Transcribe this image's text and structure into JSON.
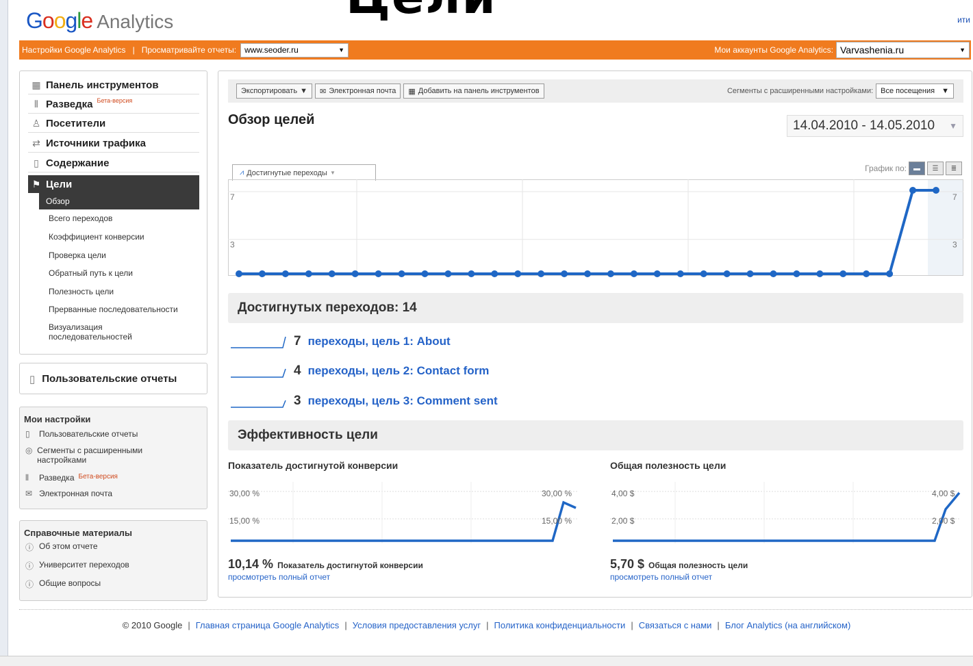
{
  "slide_title": "Цели",
  "header": {
    "logo_google": "Google",
    "logo_product": "Analytics",
    "top_right": "ити"
  },
  "orangebar": {
    "settings_link": "Настройки Google Analytics",
    "view_reports_label": "Просматривайте отчеты:",
    "site_select": "www.seoder.ru",
    "accounts_label": "Мои аккаунты Google Analytics:",
    "account_select": "Varvashenia.ru"
  },
  "sidebar": {
    "items": [
      {
        "label": "Панель инструментов",
        "icon": "dashboard-icon"
      },
      {
        "label": "Разведка",
        "beta": "Бета-версия",
        "icon": "chart-icon"
      },
      {
        "label": "Посетители",
        "icon": "person-icon"
      },
      {
        "label": "Источники трафика",
        "icon": "traffic-icon"
      },
      {
        "label": "Содержание",
        "icon": "page-icon"
      },
      {
        "label": "Цели",
        "icon": "flag-icon"
      }
    ],
    "sub_items": [
      "Обзор",
      "Всего переходов",
      "Коэффициент конверсии",
      "Проверка цели",
      "Обратный путь к цели",
      "Полезность цели",
      "Прерванные последовательности",
      "Визуализация последовательностей"
    ]
  },
  "custom_reports": {
    "label": "Пользовательские отчеты"
  },
  "my_settings": {
    "title": "Мои настройки",
    "items": [
      {
        "label": "Пользовательские отчеты"
      },
      {
        "label": "Сегменты с расширенными настройками"
      },
      {
        "label": "Разведка",
        "beta": "Бета-версия"
      },
      {
        "label": "Электронная почта"
      }
    ]
  },
  "help": {
    "title": "Справочные материалы",
    "items": [
      "Об этом отчете",
      "Университет переходов",
      "Общие вопросы"
    ]
  },
  "toolbar": {
    "export": "Экспортировать",
    "email": "Электронная почта",
    "add_dashboard": "Добавить на панель инструментов",
    "segments_label": "Сегменты с расширенными настройками:",
    "segments_value": "Все посещения"
  },
  "main": {
    "title": "Обзор целей",
    "date_range": "14.04.2010 - 14.05.2010",
    "chart_tab": "Достигнутые переходы",
    "graph_by": "График по:"
  },
  "chart_data": {
    "type": "line",
    "ylim": [
      0,
      7
    ],
    "y_ticks_left": [
      "7",
      "3"
    ],
    "y_ticks_right": [
      "7",
      "3"
    ],
    "values": [
      0,
      0,
      0,
      0,
      0,
      0,
      0,
      0,
      0,
      0,
      0,
      0,
      0,
      0,
      0,
      0,
      0,
      0,
      0,
      0,
      0,
      0,
      0,
      0,
      0,
      0,
      0,
      0,
      0,
      7,
      7
    ]
  },
  "summary": {
    "title": "Достигнутых переходов: 14",
    "goals": [
      {
        "count": "7",
        "label": "переходы, цель 1: About"
      },
      {
        "count": "4",
        "label": "переходы, цель 2: Contact form"
      },
      {
        "count": "3",
        "label": "переходы, цель 3: Comment sent"
      }
    ]
  },
  "efficiency": {
    "title": "Эффективность цели",
    "conversion": {
      "title": "Показатель достигнутой конверсии",
      "tick_top": "30,00 %",
      "tick_mid": "15,00 %",
      "tick_top_r": "30,00 %",
      "tick_mid_r": "15,00 %",
      "value": "10,14 %",
      "value_label": "Показатель достигнутой конверсии",
      "link": "просмотреть полный отчет"
    },
    "value": {
      "title": "Общая полезность цели",
      "tick_top": "4,00 $",
      "tick_mid": "2,00 $",
      "tick_top_r": "4,00 $",
      "tick_mid_r": "2,00 $",
      "value": "5,70 $",
      "value_label": "Общая полезность цели",
      "link": "просмотреть полный отчет"
    }
  },
  "footer": {
    "copyright": "© 2010 Google",
    "links": [
      "Главная страница Google Analytics",
      "Условия предоставления услуг",
      "Политика конфиденциальности",
      "Связаться с нами",
      "Блог Analytics (на английском)"
    ]
  },
  "colors": {
    "orange": "#f07b1f",
    "line": "#1f67c5",
    "link": "#2563c8"
  }
}
